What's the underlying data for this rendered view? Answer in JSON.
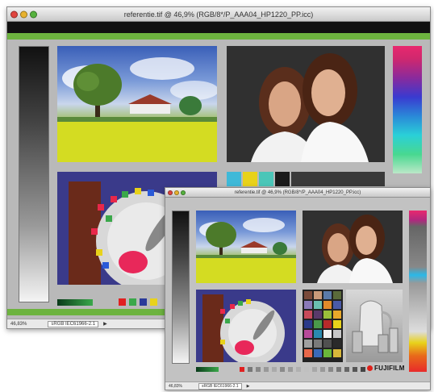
{
  "back_window": {
    "title": "referentie.tif @ 46,9% (RGB/8*/P_AAA04_HP1220_PP.icc)",
    "status_zoom": "46,83%",
    "status_profile": "sRGB IEC61966-2.1",
    "swatch_colors": [
      "#3fb9d8",
      "#e8d21a",
      "#4bc6b8",
      "#1a1a1a"
    ],
    "small_patches": [
      "#e02020",
      "#3aa84a",
      "#2a3a9a",
      "#e8d21a"
    ]
  },
  "front_window": {
    "title": "referentie.tif @ 46,9% (RGB/8*/P_AAA04_HP1220_PP.icc)",
    "status_zoom": "46,83%",
    "status_profile": "sRGB IEC61966-2.1",
    "brand": "FUJIFILM"
  },
  "colors": {
    "green_bar": "#6db33f",
    "titlebar_close": "#e0443e",
    "titlebar_min": "#e8b22e",
    "titlebar_max": "#55b23e"
  }
}
